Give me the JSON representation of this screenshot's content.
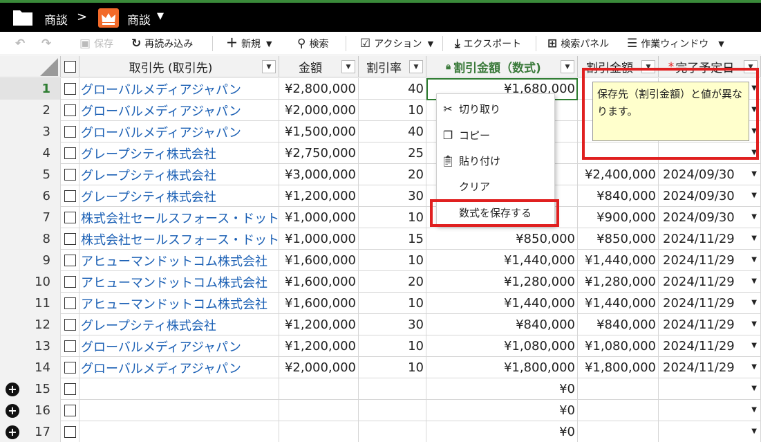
{
  "titlebar": {
    "folder_label": "商談",
    "separator": ">",
    "object_label": "商談"
  },
  "toolbar": {
    "save": "保存",
    "reload": "再読み込み",
    "new": "新規",
    "search": "検索",
    "action": "アクション",
    "export": "エクスポート",
    "search_panel": "検索パネル",
    "work_window": "作業ウィンドウ"
  },
  "columns": {
    "account": "取引先 (取引先)",
    "amount": "金額",
    "discount_rate": "割引率",
    "discount_amount_formula": "割引金額（数式)",
    "discount_amount": "割引金額",
    "close_date": "完了予定日"
  },
  "rows": [
    {
      "no": "1",
      "account": "グローバルメディアジャパン",
      "amount": "¥2,800,000",
      "rate": "40",
      "formula": "¥1,680,000",
      "disc": "",
      "date": ""
    },
    {
      "no": "2",
      "account": "グローバルメディアジャパン",
      "amount": "¥2,000,000",
      "rate": "10",
      "formula": "",
      "disc": "",
      "date": ""
    },
    {
      "no": "3",
      "account": "グローバルメディアジャパン",
      "amount": "¥1,500,000",
      "rate": "40",
      "formula": "",
      "disc": "",
      "date": ""
    },
    {
      "no": "4",
      "account": "グレープシティ株式会社",
      "amount": "¥2,750,000",
      "rate": "25",
      "formula": "",
      "disc": "",
      "date": ""
    },
    {
      "no": "5",
      "account": "グレープシティ株式会社",
      "amount": "¥3,000,000",
      "rate": "20",
      "formula": "",
      "disc": "¥2,400,000",
      "date": "2024/09/30"
    },
    {
      "no": "6",
      "account": "グレープシティ株式会社",
      "amount": "¥1,200,000",
      "rate": "30",
      "formula": "",
      "disc": "¥840,000",
      "date": "2024/09/30"
    },
    {
      "no": "7",
      "account": "株式会社セールスフォース・ドットコム",
      "amount": "¥1,000,000",
      "rate": "10",
      "formula": "",
      "disc": "¥900,000",
      "date": "2024/09/30"
    },
    {
      "no": "8",
      "account": "株式会社セールスフォース・ドットコム",
      "amount": "¥1,000,000",
      "rate": "15",
      "formula": "¥850,000",
      "disc": "¥850,000",
      "date": "2024/11/29"
    },
    {
      "no": "9",
      "account": "アヒューマンドットコム株式会社",
      "amount": "¥1,600,000",
      "rate": "10",
      "formula": "¥1,440,000",
      "disc": "¥1,440,000",
      "date": "2024/11/29"
    },
    {
      "no": "10",
      "account": "アヒューマンドットコム株式会社",
      "amount": "¥1,600,000",
      "rate": "20",
      "formula": "¥1,280,000",
      "disc": "¥1,280,000",
      "date": "2024/11/29"
    },
    {
      "no": "11",
      "account": "アヒューマンドットコム株式会社",
      "amount": "¥1,600,000",
      "rate": "10",
      "formula": "¥1,440,000",
      "disc": "¥1,440,000",
      "date": "2024/11/29"
    },
    {
      "no": "12",
      "account": "グレープシティ株式会社",
      "amount": "¥1,200,000",
      "rate": "30",
      "formula": "¥840,000",
      "disc": "¥840,000",
      "date": "2024/11/29"
    },
    {
      "no": "13",
      "account": "グローバルメディアジャパン",
      "amount": "¥1,200,000",
      "rate": "10",
      "formula": "¥1,080,000",
      "disc": "¥1,080,000",
      "date": "2024/11/29"
    },
    {
      "no": "14",
      "account": "グローバルメディアジャパン",
      "amount": "¥2,000,000",
      "rate": "10",
      "formula": "¥1,800,000",
      "disc": "¥1,800,000",
      "date": "2024/11/29"
    },
    {
      "no": "15",
      "account": "",
      "amount": "",
      "rate": "",
      "formula": "¥0",
      "disc": "",
      "date": ""
    },
    {
      "no": "16",
      "account": "",
      "amount": "",
      "rate": "",
      "formula": "¥0",
      "disc": "",
      "date": ""
    },
    {
      "no": "17",
      "account": "",
      "amount": "",
      "rate": "",
      "formula": "¥0",
      "disc": "",
      "date": ""
    }
  ],
  "context_menu": {
    "cut": "切り取り",
    "copy": "コピー",
    "paste": "貼り付け",
    "clear": "クリア",
    "save_formula": "数式を保存する"
  },
  "tooltip": {
    "text": "保存先（割引金額）と値が異なります。"
  },
  "colors": {
    "link": "#1a5fb4",
    "locked_header": "#3a7a3a",
    "highlight": "#e02020",
    "tooltip_bg": "#ffffcc",
    "selected_row": "#2e7d32",
    "titlebar_accent": "#3a8a3a",
    "crown": "#f26a2a"
  }
}
